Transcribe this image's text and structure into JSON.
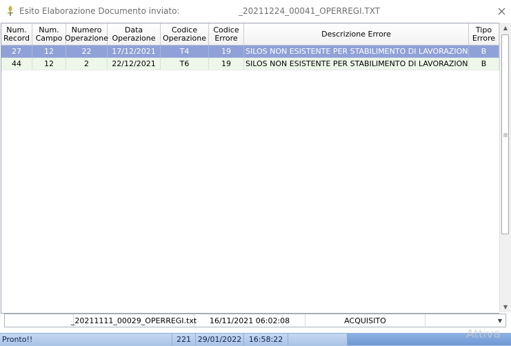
{
  "window": {
    "title_label": "Esito Elaborazione Documento inviato:",
    "title_file": "_20211224_00041_OPERREGI.TXT",
    "close_icon": "close-icon",
    "app_icon": "app-logo-icon"
  },
  "grid": {
    "columns": [
      {
        "key": "num_record",
        "line1": "Num.",
        "line2": "Record"
      },
      {
        "key": "num_campo",
        "line1": "Num.",
        "line2": "Campo"
      },
      {
        "key": "numero_operazione",
        "line1": "Numero",
        "line2": "Operazione"
      },
      {
        "key": "data_operazione",
        "line1": "Data",
        "line2": "Operazione"
      },
      {
        "key": "codice_operazione",
        "line1": "Codice",
        "line2": "Operazione"
      },
      {
        "key": "codice_errore",
        "line1": "Codice",
        "line2": "Errore"
      },
      {
        "key": "descrizione_errore",
        "line1": "Descrizione Errore",
        "line2": ""
      },
      {
        "key": "tipo_errore",
        "line1": "Tipo",
        "line2": "Errore"
      }
    ],
    "rows": [
      [
        "27",
        "12",
        "22",
        "17/12/2021",
        "T4",
        "19",
        "SILOS NON ESISTENTE PER STABILIMENTO DI LAVORAZIONE",
        "B"
      ],
      [
        "44",
        "12",
        "2",
        "22/12/2021",
        "T6",
        "19",
        "SILOS NON ESISTENTE PER STABILIMENTO DI LAVORAZIONE",
        "B"
      ]
    ],
    "selected_row_color": "#8fa1d6",
    "alt_row_color": "#eef8ea"
  },
  "combo": {
    "file": "_20211111_00029_OPERREGI.txt",
    "datetime": "16/11/2021  06:02:08",
    "status": "ACQUISITO"
  },
  "statusbar": {
    "message": "Pronto!!",
    "count": "221",
    "date": "29/01/2022",
    "time": "16:58:22"
  },
  "watermark": {
    "text": "Attiva"
  }
}
